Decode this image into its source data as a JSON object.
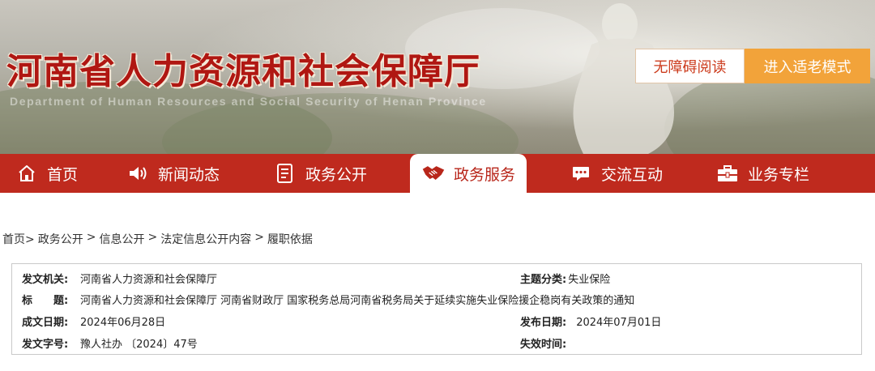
{
  "header": {
    "title": "河南省人力资源和社会保障厅",
    "subtitle": "Department of Human Resources and Social Security of Henan Province",
    "accessibility_button": "无障碍阅读",
    "elder_mode_button": "进入适老模式"
  },
  "nav": {
    "items": [
      {
        "label": "首页",
        "icon": "home-icon"
      },
      {
        "label": "新闻动态",
        "icon": "speaker-icon"
      },
      {
        "label": "政务公开",
        "icon": "document-icon"
      },
      {
        "label": "政务服务",
        "icon": "handshake-icon",
        "active": true
      },
      {
        "label": "交流互动",
        "icon": "chat-icon"
      },
      {
        "label": "业务专栏",
        "icon": "briefcase-icon"
      }
    ]
  },
  "breadcrumb": {
    "items": [
      "首页>",
      "政务公开",
      "信息公开",
      "法定信息公开内容",
      "履职依据"
    ],
    "separator": ">"
  },
  "document_info": {
    "issuer_label": "发文机关:",
    "issuer": "河南省人力资源和社会保障厅",
    "topic_label": "主题分类:",
    "topic": "失业保险",
    "title_label": "标　　题:",
    "title": "河南省人力资源和社会保障厅 河南省财政厅 国家税务总局河南省税务局关于延续实施失业保险援企稳岗有关政策的通知",
    "written_date_label": "成文日期:",
    "written_date": "2024年06月28日",
    "publish_date_label": "发布日期:",
    "publish_date": "2024年07月01日",
    "doc_number_label": "发文字号:",
    "doc_number": "豫人社办 〔2024〕47号",
    "expiry_label": "失效时间:",
    "expiry": ""
  },
  "colors": {
    "nav_red": "#bf2a1e",
    "title_red": "#b01712",
    "elder_orange": "#f2a33a",
    "access_text": "#cc3b1c"
  }
}
